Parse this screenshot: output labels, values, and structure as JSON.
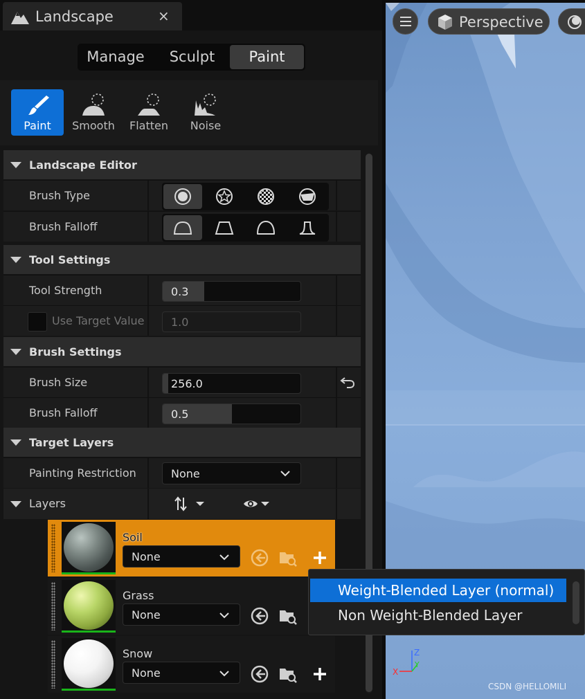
{
  "tab": {
    "title": "Landscape",
    "close": "×"
  },
  "modes": [
    "Manage",
    "Sculpt",
    "Paint"
  ],
  "tools": [
    "Paint",
    "Smooth",
    "Flatten",
    "Noise"
  ],
  "sections": {
    "landscape_editor": "Landscape Editor",
    "tool_settings": "Tool Settings",
    "brush_settings": "Brush Settings",
    "target_layers": "Target Layers"
  },
  "props": {
    "brush_type": "Brush Type",
    "brush_falloff_type": "Brush Falloff",
    "tool_strength": {
      "label": "Tool Strength",
      "value": "0.3",
      "fill": 0.3
    },
    "use_target_value": {
      "label": "Use Target Value",
      "value": "1.0"
    },
    "brush_size": {
      "label": "Brush Size",
      "value": "256.0",
      "fill": 0.04
    },
    "brush_falloff": {
      "label": "Brush Falloff",
      "value": "0.5",
      "fill": 0.5
    },
    "painting_restriction": {
      "label": "Painting Restriction",
      "value": "None"
    }
  },
  "layers": {
    "header": "Layers",
    "items": [
      {
        "name": "Soil",
        "value": "None"
      },
      {
        "name": "Grass",
        "value": "None"
      },
      {
        "name": "Snow",
        "value": "None"
      }
    ]
  },
  "viewport": {
    "mode": "Perspective",
    "watermark": "CSDN @HELLOMILI"
  },
  "popup": {
    "items": [
      "Weight-Blended Layer (normal)",
      "Non Weight-Blended Layer"
    ]
  },
  "colors": {
    "accent": "#0e6fd6",
    "selected_layer": "#e18a0d",
    "panel": "#151515"
  }
}
